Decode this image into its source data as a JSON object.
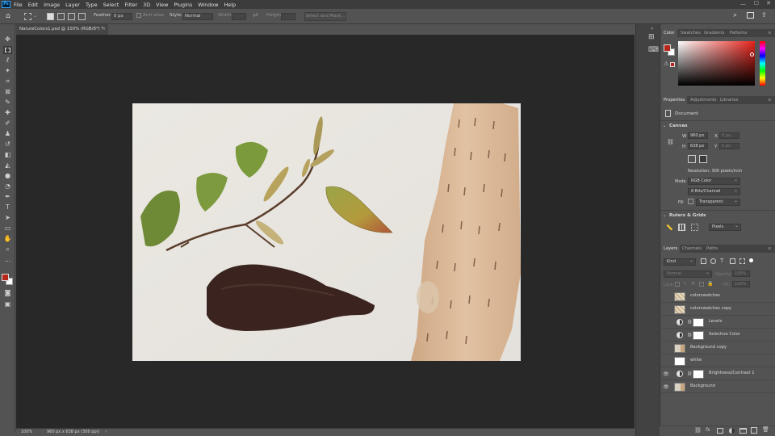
{
  "app": {
    "logo": "Ps"
  },
  "menu": [
    "File",
    "Edit",
    "Image",
    "Layer",
    "Type",
    "Select",
    "Filter",
    "3D",
    "View",
    "Plugins",
    "Window",
    "Help"
  ],
  "options": {
    "feather_label": "Feather:",
    "feather_value": "0 px",
    "antialias_label": "Anti-alias",
    "style_label": "Style:",
    "style_value": "Normal",
    "width_label": "Width:",
    "height_label": "Height:",
    "select_mask_label": "Select and Mask..."
  },
  "document": {
    "tab_title": "NatureColors1.psd @ 100% (RGB/8*) *",
    "close_glyph": "×"
  },
  "status": {
    "zoom": "100%",
    "doc_info": "960 px x 638 px (300 ppi)",
    "arrow": "›"
  },
  "colors": {
    "foreground": "#b8261b",
    "background": "#ffffff",
    "picker_hue": "#d9261f"
  },
  "color_panel": {
    "tabs": [
      "Color",
      "Swatches",
      "Gradients",
      "Patterns"
    ],
    "active": "Color"
  },
  "properties_panel": {
    "tabs": [
      "Properties",
      "Adjustments",
      "Libraries"
    ],
    "active": "Properties",
    "doc_label": "Document",
    "canvas_section": "Canvas",
    "w_label": "W",
    "w_value": "960 px",
    "h_label": "H",
    "h_value": "638 px",
    "x_label": "X",
    "x_value": "0 px",
    "y_label": "Y",
    "y_value": "0 px",
    "resolution": "Resolution: 300 pixels/inch",
    "mode_label": "Mode",
    "mode_value": "RGB Color",
    "bits_value": "8 Bits/Channel",
    "fill_label": "Fill",
    "fill_value": "Transparent",
    "rulers_section": "Rulers & Grids",
    "units_value": "Pixels"
  },
  "layers_panel": {
    "tabs": [
      "Layers",
      "Channels",
      "Paths"
    ],
    "active": "Layers",
    "kind_value": "Kind",
    "blend_value": "Normal",
    "opacity_label": "Opacity:",
    "opacity_value": "100%",
    "lock_label": "Lock:",
    "fill_label": "Fill:",
    "fill_value": "100%",
    "layers": [
      {
        "name": "colorswatches",
        "visible": false,
        "type": "pixel"
      },
      {
        "name": "colorswatches copy",
        "visible": false,
        "type": "pixel"
      },
      {
        "name": "Levels",
        "visible": false,
        "type": "adjustment"
      },
      {
        "name": "Selective Color",
        "visible": false,
        "type": "adjustment"
      },
      {
        "name": "Background copy",
        "visible": false,
        "type": "pixel"
      },
      {
        "name": "white",
        "visible": false,
        "type": "white"
      },
      {
        "name": "Brightness/Contrast 1",
        "visible": true,
        "type": "adjustment"
      },
      {
        "name": "Background",
        "visible": true,
        "type": "pixel"
      }
    ],
    "footer_icons": [
      "link-icon",
      "fx-icon",
      "mask-icon",
      "adjustment-icon",
      "group-icon",
      "new-layer-icon",
      "trash-icon"
    ]
  }
}
